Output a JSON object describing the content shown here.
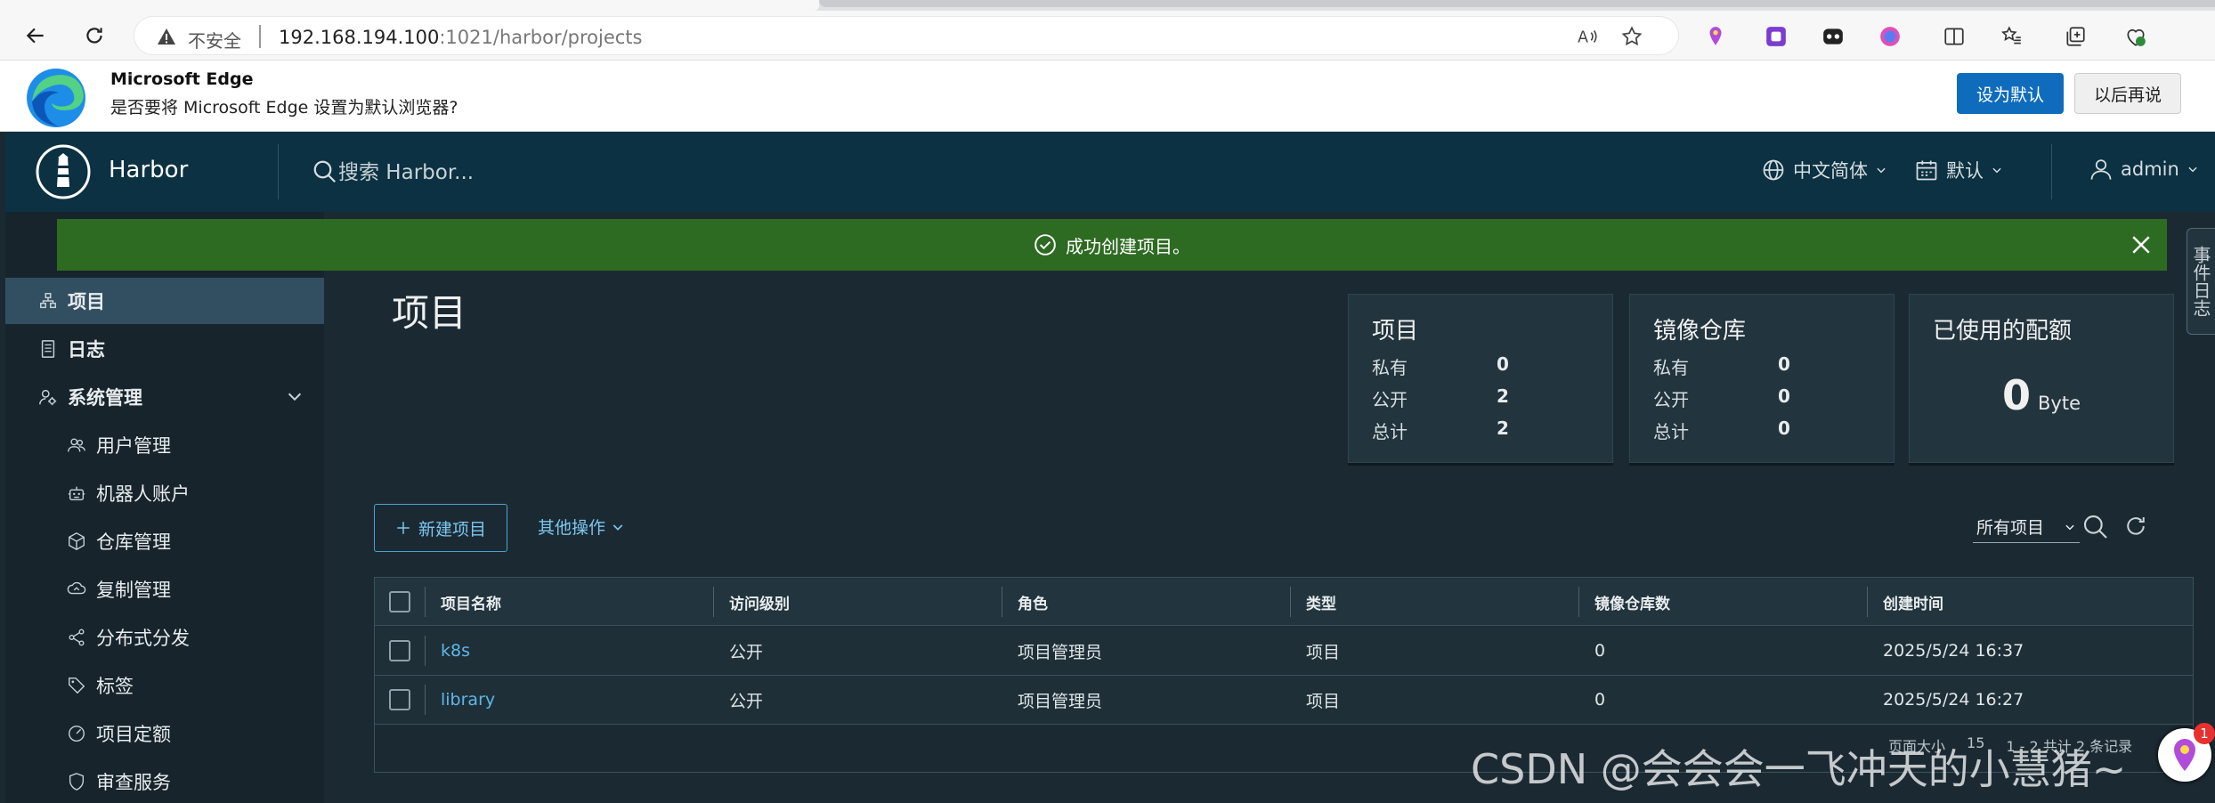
{
  "browser": {
    "insecure_label": "不安全",
    "url_host": "192.168.194.100",
    "url_rest": ":1021/harbor/projects"
  },
  "infobar": {
    "title": "Microsoft Edge",
    "text": "是否要将 Microsoft Edge 设置为默认浏览器?",
    "primary_button": "设为默认",
    "secondary_button": "以后再说"
  },
  "header": {
    "brand": "Harbor",
    "search_placeholder": "搜索 Harbor...",
    "language": "中文简体",
    "theme": "默认",
    "user": "admin"
  },
  "alert": {
    "message": "成功创建项目。"
  },
  "event_log_tab": "事件日志",
  "sidebar": {
    "items": [
      {
        "label": "项目",
        "icon": "project-icon"
      },
      {
        "label": "日志",
        "icon": "log-icon"
      },
      {
        "label": "系统管理",
        "icon": "admin-icon"
      }
    ],
    "sub_items": [
      {
        "label": "用户管理",
        "icon": "users-icon"
      },
      {
        "label": "机器人账户",
        "icon": "robot-icon"
      },
      {
        "label": "仓库管理",
        "icon": "registry-icon"
      },
      {
        "label": "复制管理",
        "icon": "replication-icon"
      },
      {
        "label": "分布式分发",
        "icon": "share-icon"
      },
      {
        "label": "标签",
        "icon": "tag-icon"
      },
      {
        "label": "项目定额",
        "icon": "quota-icon"
      },
      {
        "label": "审查服务",
        "icon": "shield-icon"
      }
    ]
  },
  "main": {
    "title": "项目",
    "cards": {
      "projects": {
        "title": "项目",
        "private_label": "私有",
        "private": "0",
        "public_label": "公开",
        "public": "2",
        "total_label": "总计",
        "total": "2"
      },
      "repos": {
        "title": "镜像仓库",
        "private_label": "私有",
        "private": "0",
        "public_label": "公开",
        "public": "0",
        "total_label": "总计",
        "total": "0"
      },
      "quota": {
        "title": "已使用的配额",
        "value": "0",
        "unit": "Byte"
      }
    },
    "new_project": "新建项目",
    "other_actions": "其他操作",
    "filter": "所有项目"
  },
  "table": {
    "columns": [
      "项目名称",
      "访问级别",
      "角色",
      "类型",
      "镜像仓库数",
      "创建时间"
    ],
    "rows": [
      [
        "k8s",
        "公开",
        "项目管理员",
        "项目",
        "0",
        "2025/5/24 16:37"
      ],
      [
        "library",
        "公开",
        "项目管理员",
        "项目",
        "0",
        "2025/5/24 16:27"
      ]
    ],
    "footer_page_size_label": "页面大小",
    "footer_page_size": "15",
    "footer_total": "1 - 2 共计 2 条记录"
  },
  "watermark": "CSDN @会会会一飞冲天的小慧猪~",
  "floater_badge": "1"
}
